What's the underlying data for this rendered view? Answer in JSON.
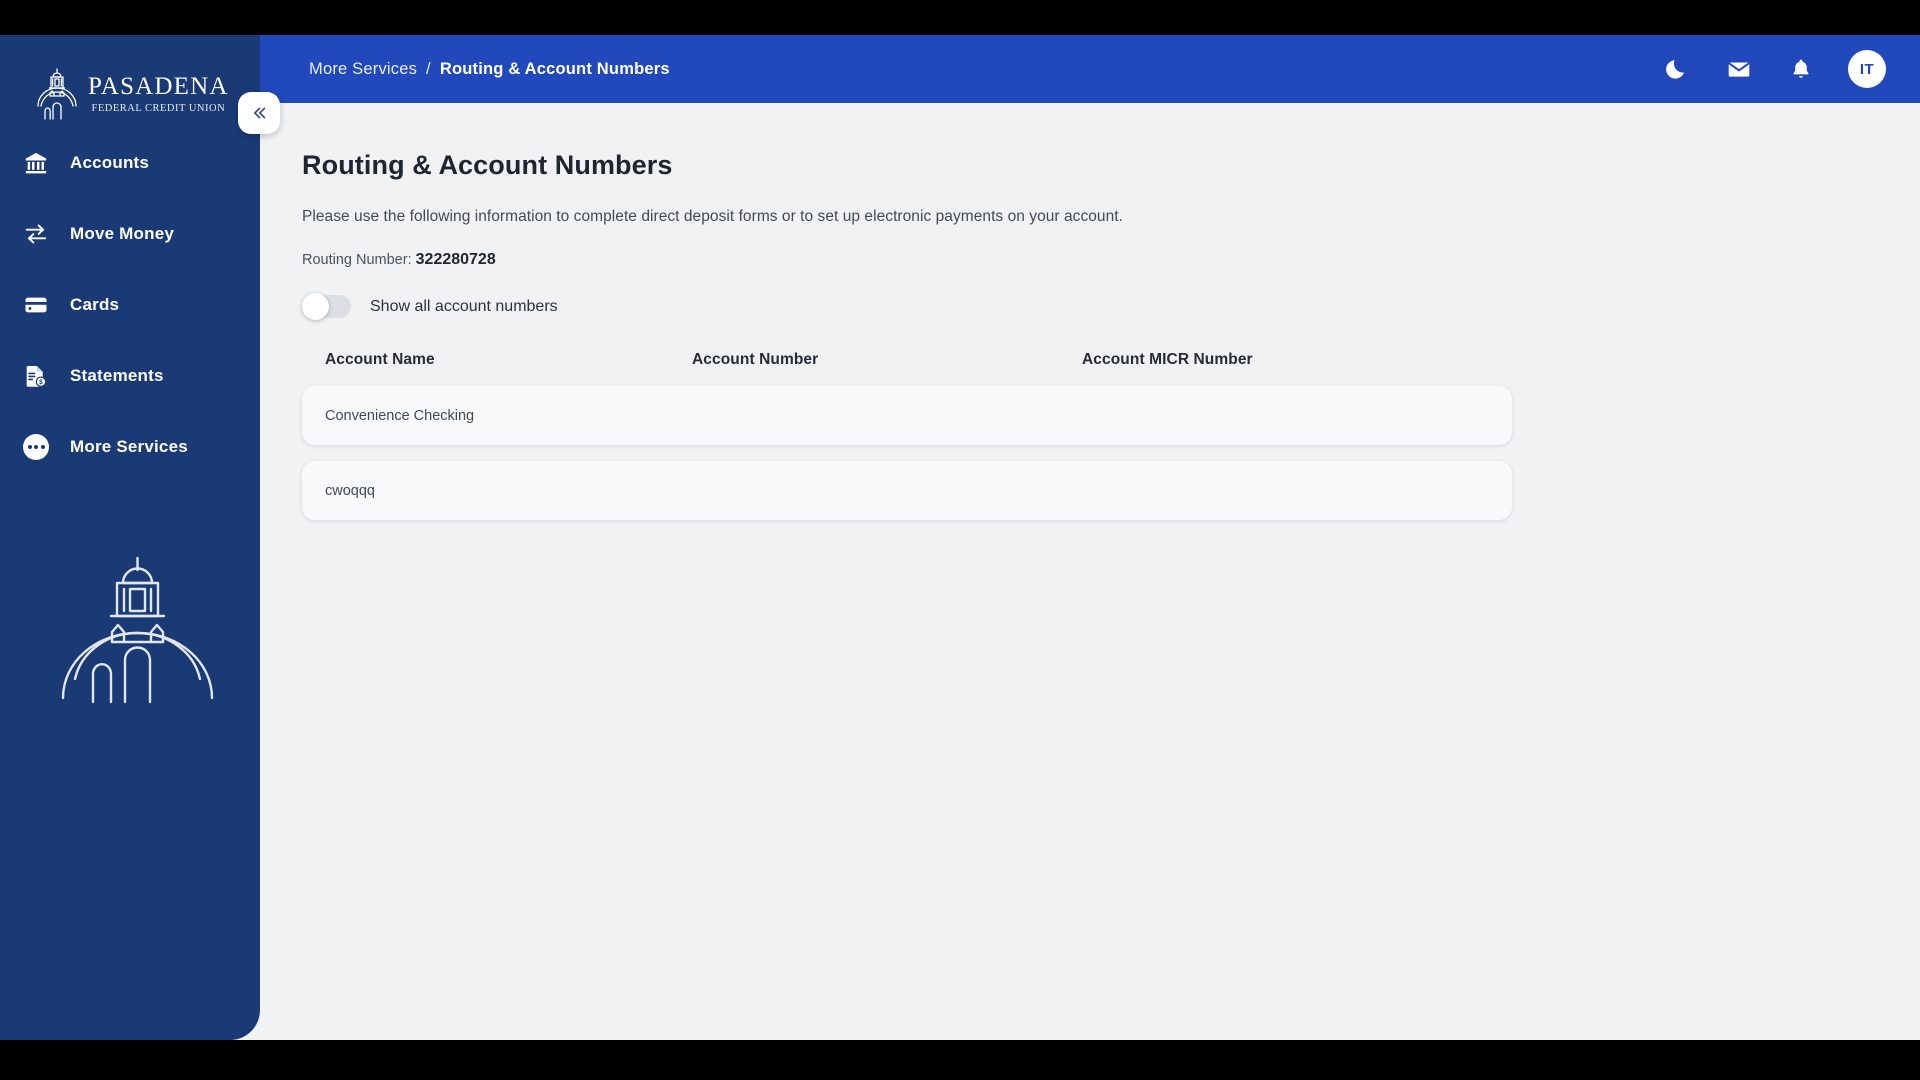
{
  "brand": {
    "name": "PASADENA",
    "subtitle": "FEDERAL CREDIT UNION",
    "logo_icon": "city-hall-dome-icon",
    "watermark_icon": "city-hall-dome-watermark-icon"
  },
  "colors": {
    "sidebar_bg": "#1A3A76",
    "header_bg": "#2149BC",
    "content_bg": "#F1F2F4",
    "card_bg": "#F8F9FA",
    "title_text": "#1e2430",
    "toggle_track_off": "#dcdfe4"
  },
  "sidebar": {
    "items": [
      {
        "label": "Accounts",
        "icon": "bank-icon",
        "active": false
      },
      {
        "label": "Move Money",
        "icon": "transfer-arrows-icon",
        "active": false
      },
      {
        "label": "Cards",
        "icon": "credit-card-icon",
        "active": false
      },
      {
        "label": "Statements",
        "icon": "document-dollar-icon",
        "active": false
      },
      {
        "label": "More Services",
        "icon": "ellipsis-circle-icon",
        "active": true
      }
    ]
  },
  "header": {
    "collapse_button_icon": "double-chevron-left-icon",
    "breadcrumb": {
      "parent": "More Services",
      "separator": "/",
      "current": "Routing & Account Numbers"
    },
    "actions": [
      {
        "name": "dark-mode-toggle",
        "icon": "crescent-moon-icon"
      },
      {
        "name": "messages-button",
        "icon": "envelope-icon"
      },
      {
        "name": "notifications-button",
        "icon": "bell-icon"
      }
    ],
    "avatar_initials": "IT"
  },
  "main": {
    "title": "Routing & Account Numbers",
    "description": "Please use the following information to complete direct deposit forms or to set up electronic payments on your account.",
    "routing_label": "Routing Number:",
    "routing_number": "322280728",
    "toggle": {
      "label": "Show all account numbers",
      "state": "off"
    },
    "table": {
      "columns": [
        "Account Name",
        "Account Number",
        "Account MICR Number"
      ],
      "rows": [
        {
          "account_name": "Convenience Checking",
          "account_number": "",
          "micr_number": ""
        },
        {
          "account_name": "cwoqqq",
          "account_number": "",
          "micr_number": ""
        }
      ]
    }
  }
}
